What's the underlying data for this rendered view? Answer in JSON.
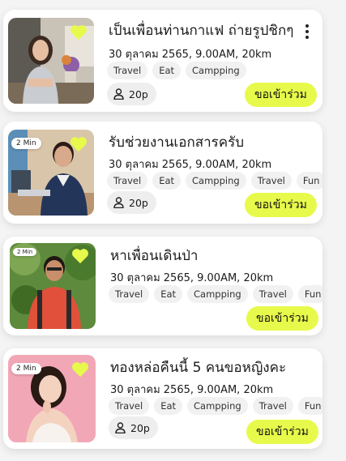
{
  "colors": {
    "accent": "#e7fa4b",
    "heart": "#e7fa4b",
    "card": "#ffffff",
    "tag_bg": "#f1f1f1"
  },
  "icons": {
    "favorite": "heart-icon",
    "people": "person-icon",
    "menu": "more-vertical-icon"
  },
  "cards": [
    {
      "title": "เป็นเพื่อนท่านกาแฟ ถ่ายรูปชิกๆ",
      "meta": "30 ตุลาคม 2565,  9.00AM,  20km",
      "tags": [
        "Travel",
        "Eat",
        "Campping"
      ],
      "people": "20p",
      "join_label": "ขอเข้าร่วม",
      "time_badge": ""
    },
    {
      "title": "รับช่วยงานเอกสารครับ",
      "meta": "30 ตุลาคม 2565,  9.00AM,  20km",
      "tags": [
        "Travel",
        "Eat",
        "Campping",
        "Travel",
        "Fun"
      ],
      "people": "20p",
      "join_label": "ขอเข้าร่วม",
      "time_badge": "2 Min"
    },
    {
      "title": "หาเพื่อนเดินป่า",
      "meta": "30 ตุลาคม 2565,  9.00AM,  20km",
      "tags": [
        "Travel",
        "Eat",
        "Campping",
        "Travel",
        "Fun"
      ],
      "people": "",
      "join_label": "ขอเข้าร่วม",
      "time_badge": "2 Min"
    },
    {
      "title": "ทองหล่อคืนนี้ 5 คนขอหญิงคะ",
      "meta": "30 ตุลาคม 2565,  9.00AM,  20km",
      "tags": [
        "Travel",
        "Eat",
        "Campping",
        "Travel",
        "Fun"
      ],
      "people": "20p",
      "join_label": "ขอเข้าร่วม",
      "time_badge": "2 Min"
    }
  ]
}
